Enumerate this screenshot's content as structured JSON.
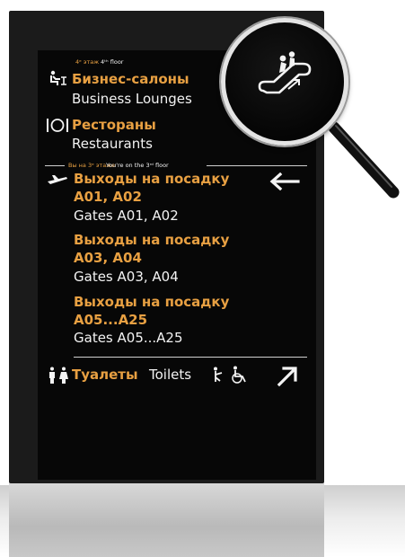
{
  "sign": {
    "floor4_label_ru": "4ᵉ этаж",
    "floor4_label_en": "4ᵗʰ floor",
    "business_lounges_ru": "Бизнес-салоны",
    "business_lounges_en": "Business Lounges",
    "restaurants_ru": "Рестораны",
    "restaurants_en": "Restaurants",
    "floor3_label_ru": "Вы на 3ᵉ этаже",
    "floor3_label_en": "You're on the 3ʳᵈ floor",
    "gates_1_ru": [
      "Выходы на посадку",
      "A01, A02"
    ],
    "gates_1_en": "Gates A01, A02",
    "gates_2_ru": [
      "Выходы на посадку",
      "A03, A04"
    ],
    "gates_2_en": "Gates A03, A04",
    "gates_3_ru": [
      "Выходы на посадку",
      "A05...A25"
    ],
    "gates_3_en": "Gates A05...A25",
    "toilets_ru": "Туалеты",
    "toilets_en": "Toilets"
  },
  "icons": {
    "lounge": "lounge-chair-icon",
    "restaurant": "restaurant-plate-icon",
    "plane": "departing-plane-icon",
    "arrow_left": "arrow-left-icon",
    "toilets": "toilets-icon",
    "baby": "baby-change-icon",
    "wheelchair": "wheelchair-icon",
    "arrow_up_right": "arrow-up-right-icon",
    "escalator": "escalator-up-icon",
    "magnifier": "magnifying-glass-icon"
  },
  "colors": {
    "accent": "#e8a042",
    "text": "#f3f3f3",
    "screen": "#070707"
  }
}
